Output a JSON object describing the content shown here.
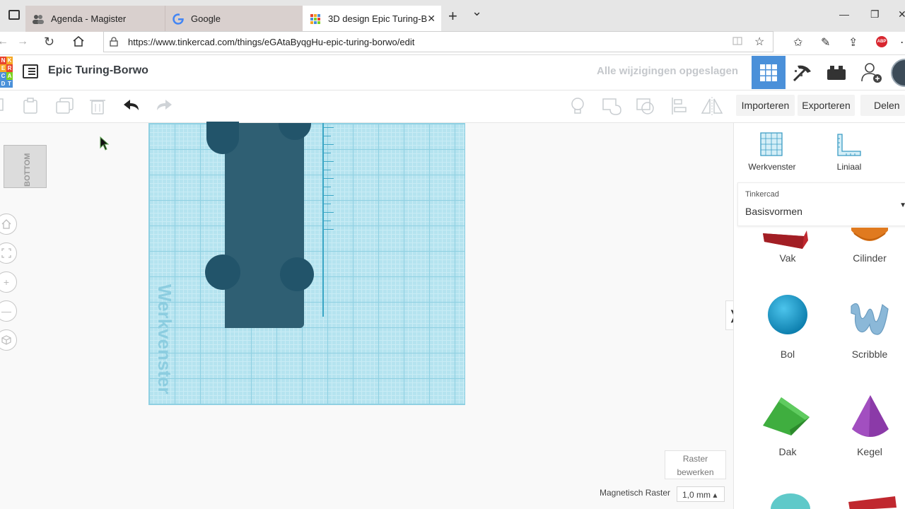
{
  "browser": {
    "tabs": [
      {
        "label": "Agenda - Magister",
        "active": false
      },
      {
        "label": "Google",
        "active": false
      },
      {
        "label": "3D design Epic Turing-B",
        "active": true
      }
    ],
    "url": "https://www.tinkercad.com/things/eGAtaByqgHu-epic-turing-borwo/edit",
    "new_tab": "+",
    "tab_dropdown": "⌄",
    "window_controls": [
      "—",
      "❐",
      "✕"
    ]
  },
  "app": {
    "logo_letters": [
      "T",
      "N",
      "K",
      "E",
      "R",
      "C",
      "A",
      "D"
    ],
    "title": "Epic Turing-Borwo",
    "save_status": "Alle wijzigingen opgeslagen"
  },
  "toolbar": {
    "import_label": "Importeren",
    "export_label": "Exporteren",
    "share_label": "Delen"
  },
  "canvas": {
    "view_cube_label": "BOTTOM",
    "workplane_text": "Werkvenster",
    "snap_grid_label": "Magnetisch Raster",
    "snap_grid_value": "1,0 mm ▴",
    "edit_grid_label": [
      "Raster",
      "bewerken"
    ],
    "panel_toggle": "❭"
  },
  "panel": {
    "tools": [
      {
        "label": "Werkvenster",
        "icon": "workplane-icon"
      },
      {
        "label": "Liniaal",
        "icon": "ruler-icon"
      }
    ],
    "category_small": "Tinkercad",
    "category_value": "Basisvormen",
    "shapes": [
      {
        "label": "Vak",
        "icon": "box-shape-icon",
        "color": "#c0282f"
      },
      {
        "label": "Cilinder",
        "icon": "cylinder-shape-icon",
        "color": "#e07a1f"
      },
      {
        "label": "Bol",
        "icon": "sphere-shape-icon",
        "color": "#1a9dc9"
      },
      {
        "label": "Scribble",
        "icon": "scribble-shape-icon",
        "color": "#8bb8d8"
      },
      {
        "label": "Dak",
        "icon": "roof-shape-icon",
        "color": "#3fae3f"
      },
      {
        "label": "Kegel",
        "icon": "cone-shape-icon",
        "color": "#8b3aa8"
      }
    ]
  },
  "colors": {
    "accent": "#4a90d9",
    "workplane": "#b5e3ef",
    "object": "#2f5f73"
  }
}
